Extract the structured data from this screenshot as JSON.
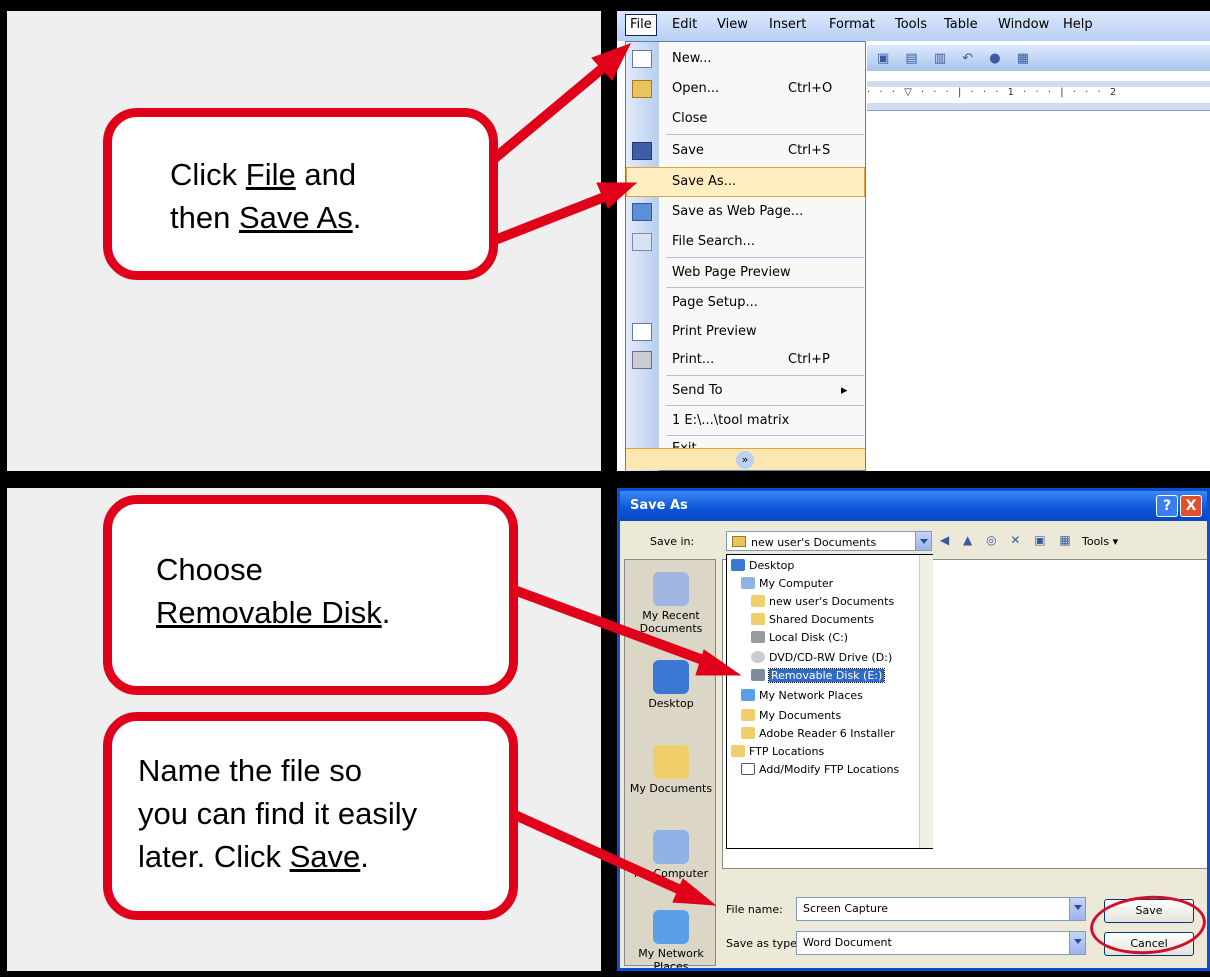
{
  "row1": {
    "callout": {
      "line1_prefix": "Click ",
      "line1_link": "File",
      "line1_suffix": " and",
      "line2_prefix": "then ",
      "line2_link": "Save As",
      "line2_suffix": "."
    }
  },
  "row2": {
    "callout1": {
      "line1": "Choose",
      "line2_link": "Removable Disk",
      "line2_suffix": "."
    },
    "callout2": {
      "line1": "Name the file so",
      "line2": "you can find it easily",
      "line3_prefix": "later. Click ",
      "line3_link": "Save",
      "line3_suffix": "."
    }
  },
  "colors": {
    "callout_border": "#e0001a",
    "arrow": "#e0001a",
    "highlight": "#ffeec2",
    "titlebar": "#0a55d9"
  },
  "word": {
    "menubar": [
      "File",
      "Edit",
      "View",
      "Insert",
      "Format",
      "Tools",
      "Table",
      "Window",
      "Help"
    ],
    "ruler_text": "· · · ▽ · · · | · · · 1 · · · | · · · 2",
    "file_menu": [
      {
        "label": "New...",
        "shortcut": "",
        "icon": "new-doc-icon"
      },
      {
        "label": "Open...",
        "shortcut": "Ctrl+O",
        "icon": "open-folder-icon"
      },
      {
        "label": "Close",
        "shortcut": "",
        "icon": ""
      },
      {
        "label": "Save",
        "shortcut": "Ctrl+S",
        "icon": "save-disk-icon"
      },
      {
        "label": "Save As...",
        "shortcut": "",
        "icon": ""
      },
      {
        "label": "Save as Web Page...",
        "shortcut": "",
        "icon": "web-page-icon"
      },
      {
        "label": "File Search...",
        "shortcut": "",
        "icon": "file-search-icon"
      },
      {
        "label": "Web Page Preview",
        "shortcut": "",
        "icon": ""
      },
      {
        "label": "Page Setup...",
        "shortcut": "",
        "icon": ""
      },
      {
        "label": "Print Preview",
        "shortcut": "",
        "icon": "print-preview-icon"
      },
      {
        "label": "Print...",
        "shortcut": "Ctrl+P",
        "icon": "printer-icon"
      },
      {
        "label": "Send To",
        "shortcut": "▸",
        "icon": ""
      },
      {
        "label": "1 E:\\...\\tool matrix",
        "shortcut": "",
        "icon": ""
      },
      {
        "label": "Exit",
        "shortcut": "",
        "icon": ""
      }
    ],
    "expand_glyph": "»"
  },
  "dialog": {
    "title": "Save As",
    "help_glyph": "?",
    "close_glyph": "X",
    "save_in_label": "Save in:",
    "save_in_value": "new user's Documents",
    "tools_label": "Tools ▾",
    "places": [
      "My Recent Documents",
      "Desktop",
      "My Documents",
      "My Computer",
      "My Network Places"
    ],
    "dropdown": [
      {
        "label": "Desktop",
        "indent": 0
      },
      {
        "label": "My Computer",
        "indent": 1
      },
      {
        "label": "new user's Documents",
        "indent": 2
      },
      {
        "label": "Shared Documents",
        "indent": 2
      },
      {
        "label": "Local Disk (C:)",
        "indent": 2
      },
      {
        "label": "DVD/CD-RW Drive (D:)",
        "indent": 2
      },
      {
        "label": "Removable Disk (E:)",
        "indent": 2
      },
      {
        "label": "My Network Places",
        "indent": 1
      },
      {
        "label": "My Documents",
        "indent": 1
      },
      {
        "label": "Adobe Reader 6 Installer",
        "indent": 1
      },
      {
        "label": "FTP Locations",
        "indent": 0
      },
      {
        "label": "Add/Modify FTP Locations",
        "indent": 1
      }
    ],
    "file_name_label": "File name:",
    "file_name_value": "Screen Capture",
    "save_type_label": "Save as type:",
    "save_type_value": "Word Document",
    "save_button": "Save",
    "cancel_button": "Cancel"
  }
}
